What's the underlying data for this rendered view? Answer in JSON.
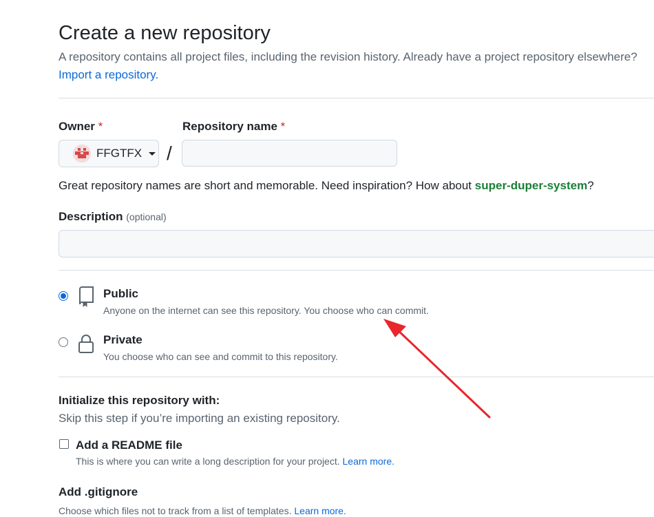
{
  "header": {
    "title": "Create a new repository",
    "subtitle": "A repository contains all project files, including the revision history. Already have a project repository elsewhere?",
    "import_link": "Import a repository."
  },
  "owner": {
    "label": "Owner",
    "required_mark": "*",
    "selected": "FFGTFX",
    "avatar_icon": "identicon-avatar"
  },
  "separator": "/",
  "repo_name": {
    "label": "Repository name",
    "required_mark": "*",
    "value": "",
    "placeholder": ""
  },
  "name_hint": {
    "text": "Great repository names are short and memorable. Need inspiration? How about ",
    "suggestion": "super-duper-system",
    "suffix": "?"
  },
  "description": {
    "label": "Description",
    "optional_label": "(optional)",
    "value": ""
  },
  "visibility": {
    "options": [
      {
        "title": "Public",
        "description": "Anyone on the internet can see this repository. You choose who can commit.",
        "icon": "repo-icon",
        "selected": true
      },
      {
        "title": "Private",
        "description": "You choose who can see and commit to this repository.",
        "icon": "lock-icon",
        "selected": false
      }
    ]
  },
  "initialize": {
    "title": "Initialize this repository with:",
    "subtitle": "Skip this step if you’re importing an existing repository.",
    "readme": {
      "label": "Add a README file",
      "description": "This is where you can write a long description for your project.",
      "learn_more": "Learn more.",
      "checked": false
    },
    "gitignore": {
      "label": "Add .gitignore",
      "description": "Choose which files not to track from a list of templates.",
      "learn_more": "Learn more."
    }
  },
  "annotation": {
    "color": "#e8262b",
    "type": "red-arrow"
  },
  "colors": {
    "link": "#0969da",
    "success": "#1a7f37",
    "danger": "#d1242f"
  }
}
